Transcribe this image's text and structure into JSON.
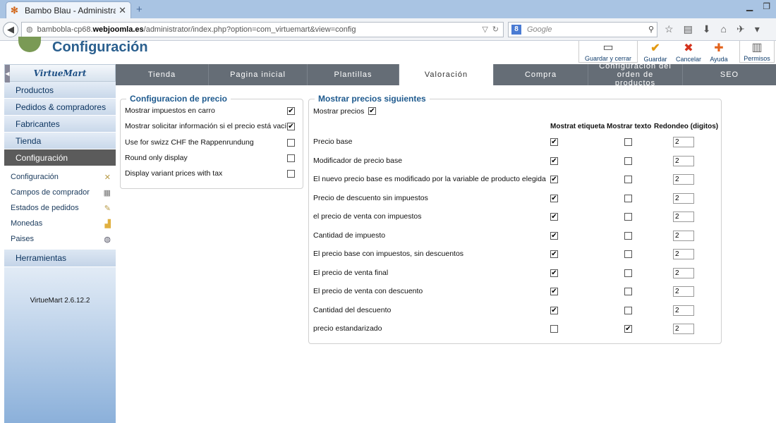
{
  "browser": {
    "tab_title": "Bambo Blau - Administraci...",
    "url_prefix": "bambobla-cp68.",
    "url_domain": "webjoomla.es",
    "url_path": "/administrator/index.php?option=com_virtuemart&view=config",
    "search_placeholder": "Google",
    "search_engine_badge": "8"
  },
  "header": {
    "title": "Configuración",
    "toolbar": [
      {
        "label": "Guardar y cerrar",
        "icon": "save-close-icon"
      },
      {
        "label": "Guardar",
        "icon": "save-check-icon"
      },
      {
        "label": "Cancelar",
        "icon": "cancel-icon"
      },
      {
        "label": "Ayuda",
        "icon": "help-icon"
      },
      {
        "label": "Permisos",
        "icon": "permissions-icon"
      }
    ]
  },
  "sidebar": {
    "logo_text": "VirtueMart",
    "main_items": [
      {
        "label": "Productos",
        "active": false
      },
      {
        "label": "Pedidos & compradores",
        "active": false
      },
      {
        "label": "Fabricantes",
        "active": false
      },
      {
        "label": "Tienda",
        "active": false
      },
      {
        "label": "Configuración",
        "active": true
      }
    ],
    "sub_items": [
      {
        "label": "Configuración",
        "icon": "config-icon"
      },
      {
        "label": "Campos de comprador",
        "icon": "fields-icon"
      },
      {
        "label": "Estados de pedidos",
        "icon": "order-states-icon"
      },
      {
        "label": "Monedas",
        "icon": "currency-icon"
      },
      {
        "label": "Paises",
        "icon": "globe-icon"
      }
    ],
    "tools_label": "Herramientas",
    "version": "VirtueMart 2.6.12.2"
  },
  "tabs": [
    {
      "label": "Tienda",
      "active": false
    },
    {
      "label": "Pagina inicial",
      "active": false
    },
    {
      "label": "Plantillas",
      "active": false
    },
    {
      "label": "Valoración",
      "active": true
    },
    {
      "label": "Compra",
      "active": false
    },
    {
      "label": "Configuración del orden de productos",
      "active": false
    },
    {
      "label": "SEO",
      "active": false
    }
  ],
  "price_config": {
    "legend": "Configuracion de precio",
    "options": [
      {
        "label": "Mostrar impuestos en carro",
        "checked": true
      },
      {
        "label": "Mostrar solicitar información si el precio está vacío",
        "checked": true
      },
      {
        "label": "Use for swizz CHF the Rappenrundung",
        "checked": false
      },
      {
        "label": "Round only display",
        "checked": false
      },
      {
        "label": "Display variant prices with tax",
        "checked": false
      }
    ]
  },
  "show_prices": {
    "legend": "Mostrar precios siguientes",
    "show_label": "Mostrar precios",
    "show_checked": true,
    "columns": [
      "Mostrat etiqueta",
      "Mostrar texto",
      "Redondeo (digitos)"
    ],
    "rows": [
      {
        "label": "Precio base",
        "label_on": true,
        "text_on": false,
        "rounding": "2"
      },
      {
        "label": "Modificador de precio base",
        "label_on": true,
        "text_on": false,
        "rounding": "2"
      },
      {
        "label": "El nuevo precio base es modificado por la variable de producto elegida",
        "label_on": true,
        "text_on": false,
        "rounding": "2"
      },
      {
        "label": "Precio de descuento sin impuestos",
        "label_on": true,
        "text_on": false,
        "rounding": "2"
      },
      {
        "label": "el precio de venta con impuestos",
        "label_on": true,
        "text_on": false,
        "rounding": "2"
      },
      {
        "label": "Cantidad de impuesto",
        "label_on": true,
        "text_on": false,
        "rounding": "2"
      },
      {
        "label": "El precio base con impuestos, sin descuentos",
        "label_on": true,
        "text_on": false,
        "rounding": "2"
      },
      {
        "label": "El precio de venta final",
        "label_on": true,
        "text_on": false,
        "rounding": "2"
      },
      {
        "label": "El precio de venta con descuento",
        "label_on": true,
        "text_on": false,
        "rounding": "2"
      },
      {
        "label": "Cantidad del descuento",
        "label_on": true,
        "text_on": false,
        "rounding": "2"
      },
      {
        "label": "precio estandarizado",
        "label_on": false,
        "text_on": true,
        "rounding": "2"
      }
    ]
  }
}
